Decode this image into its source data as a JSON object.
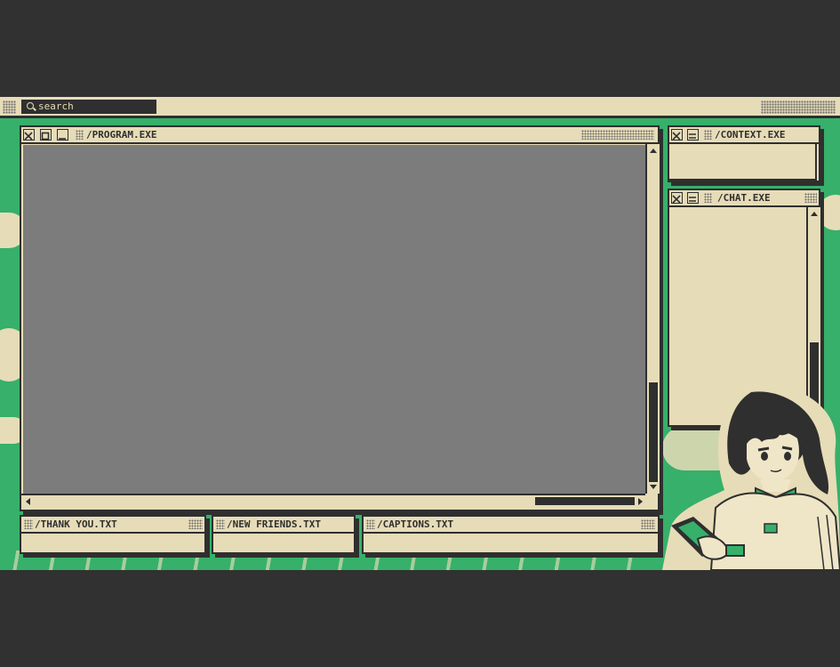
{
  "search": {
    "placeholder": "search"
  },
  "windows": {
    "program": {
      "title": "/PROGRAM.EXE"
    },
    "context": {
      "title": "/CONTEXT.EXE"
    },
    "chat": {
      "title": "/CHAT.EXE"
    },
    "thank_you": {
      "title": "/THANK YOU.TXT"
    },
    "new_friends": {
      "title": "/NEW FRIENDS.TXT"
    },
    "captions": {
      "title": "/CAPTIONS.TXT"
    }
  },
  "colors": {
    "background": "#313131",
    "cream": "#e7dcb8",
    "green": "#36b06a",
    "ink": "#2f2f2f",
    "screen": "#7c7c7c"
  },
  "character": {
    "icon": "anime-character-holding-tablet"
  }
}
